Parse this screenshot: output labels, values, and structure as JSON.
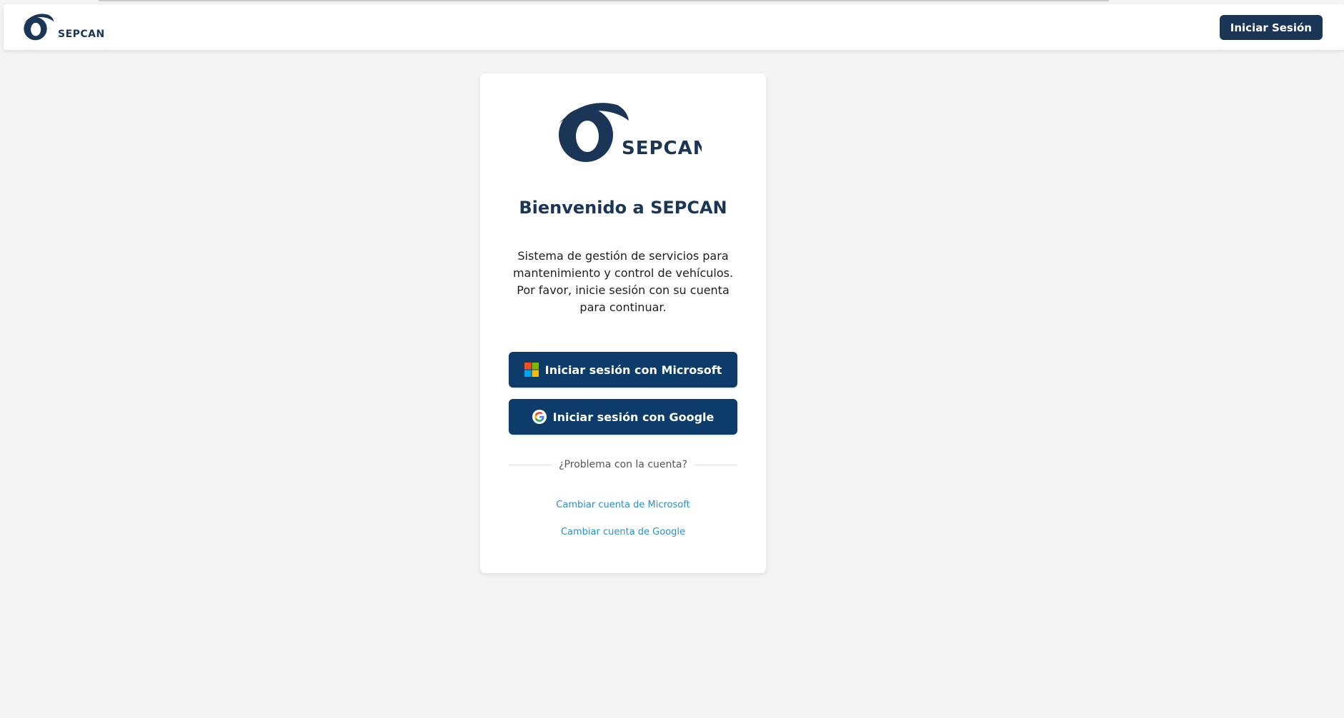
{
  "brand": {
    "name": "SEPCAN",
    "primary_color": "#1b3557",
    "button_color": "#0d3c6b",
    "link_color": "#2b8fc9"
  },
  "navbar": {
    "logo_icon": "sepcan-logo-icon",
    "logo_text": "SEPCAN",
    "login_button": "Iniciar Sesión"
  },
  "card": {
    "logo_text": "SEPCAN",
    "title": "Bienvenido a SEPCAN",
    "description": "Sistema de gestión de servicios para mantenimiento y control de vehículos. Por favor, inicie sesión con su cuenta para continuar.",
    "buttons": {
      "microsoft": {
        "label": "Iniciar sesión con Microsoft",
        "icon": "microsoft-icon"
      },
      "google": {
        "label": "Iniciar sesión con Google",
        "icon": "google-icon"
      }
    },
    "divider_text": "¿Problema con la cuenta?",
    "links": {
      "switch_microsoft": "Cambiar cuenta de Microsoft",
      "switch_google": "Cambiar cuenta de Google"
    }
  }
}
